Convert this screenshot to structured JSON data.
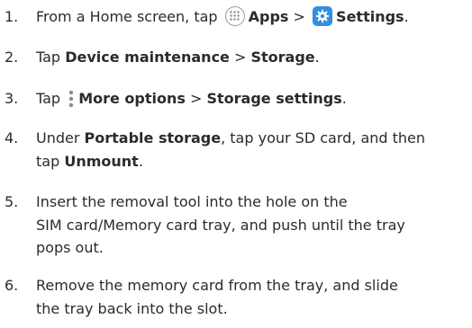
{
  "steps": [
    {
      "number": "1.",
      "t1": "From a Home screen, tap",
      "apps_label": "Apps",
      "sep": ">",
      "settings_label": "Settings",
      "end": "."
    },
    {
      "number": "2.",
      "t1": "Tap",
      "b1": "Device maintenance",
      "sep": ">",
      "b2": "Storage",
      "end": "."
    },
    {
      "number": "3.",
      "t1": "Tap",
      "b1": "More options",
      "sep": ">",
      "b2": "Storage settings",
      "end": "."
    },
    {
      "number": "4.",
      "t1": "Under",
      "b1": "Portable storage",
      "t2": ", tap your SD card, and then",
      "t3": "tap",
      "b2": "Unmount",
      "end": "."
    },
    {
      "number": "5.",
      "lines": [
        "Insert the removal tool into the hole on the",
        "SIM card/Memory card tray, and push until the tray",
        "pops out."
      ]
    },
    {
      "number": "6.",
      "lines": [
        "Remove the memory card from the tray, and slide",
        "the tray back into the slot."
      ]
    }
  ],
  "icons": {
    "apps": "apps-grid-icon",
    "settings": "gear-icon",
    "more_options": "vertical-dots-icon"
  },
  "colors": {
    "text": "#2b2b2b",
    "settings_icon_bg": "#2f8fe4"
  }
}
